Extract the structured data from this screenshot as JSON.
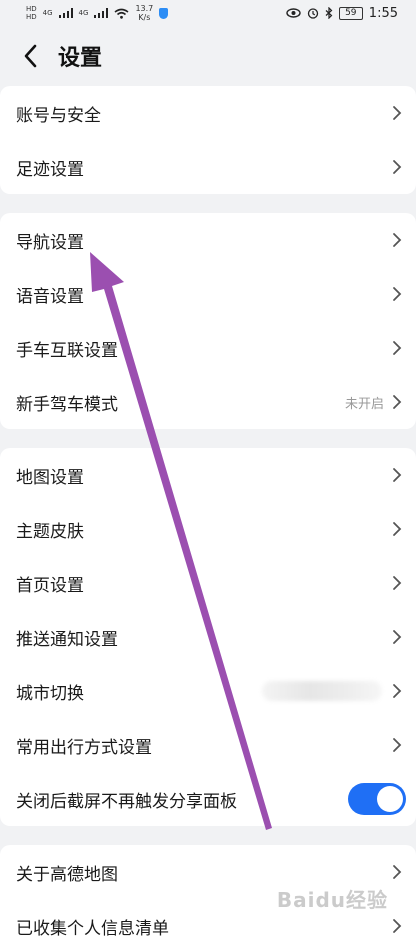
{
  "status_bar": {
    "left_labels": [
      "HD",
      "4G",
      "4G"
    ],
    "speed_value": "13.7",
    "speed_unit": "K/s",
    "battery": "59",
    "time": "1:55"
  },
  "header": {
    "title": "设置",
    "back_icon": "chevron-left-icon"
  },
  "groups": [
    {
      "items": [
        {
          "label": "账号与安全"
        },
        {
          "label": "足迹设置"
        }
      ]
    },
    {
      "items": [
        {
          "label": "导航设置"
        },
        {
          "label": "语音设置"
        },
        {
          "label": "手车互联设置"
        },
        {
          "label": "新手驾车模式",
          "value": "未开启"
        }
      ]
    },
    {
      "items": [
        {
          "label": "地图设置"
        },
        {
          "label": "主题皮肤"
        },
        {
          "label": "首页设置"
        },
        {
          "label": "推送通知设置"
        },
        {
          "label": "城市切换"
        },
        {
          "label": "常用出行方式设置"
        },
        {
          "label": "关闭后截屏不再触发分享面板",
          "toggle_on": true
        }
      ]
    },
    {
      "items": [
        {
          "label": "关于高德地图"
        },
        {
          "label": "已收集个人信息清单"
        }
      ]
    }
  ],
  "colors": {
    "toggle_on": "#1f6ff5",
    "arrow_overlay": "#9b4fb0",
    "background": "#f1f2f4"
  },
  "watermark": "Baidu经验"
}
